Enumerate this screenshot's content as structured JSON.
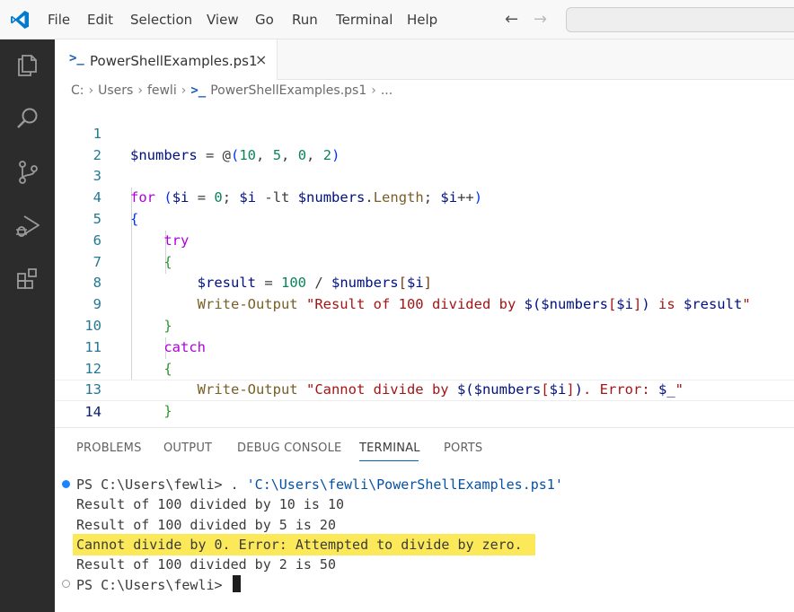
{
  "menu": [
    "File",
    "Edit",
    "Selection",
    "View",
    "Go",
    "Run",
    "Terminal",
    "Help"
  ],
  "nav": {
    "back": "←",
    "forward": "→"
  },
  "tab": {
    "label": "PowerShellExamples.ps1",
    "icon": ">_",
    "close": "×"
  },
  "breadcrumb": {
    "items": [
      "C:",
      "Users",
      "fewli"
    ],
    "file_icon": ">_",
    "file": "PowerShellExamples.ps1",
    "more": "...",
    "separator": "›"
  },
  "editor": {
    "line_numbers": [
      "1",
      "2",
      "3",
      "4",
      "5",
      "6",
      "7",
      "8",
      "9",
      "10",
      "11",
      "12",
      "13",
      "14"
    ],
    "lines": [
      "$numbers = @(10, 5, 0, 2)",
      "",
      "for ($i = 0; $i -lt $numbers.Length; $i++)",
      "{",
      "    try",
      "    {",
      "        $result = 100 / $numbers[$i]",
      "        Write-Output \"Result of 100 divided by $($numbers[$i]) is $result\"",
      "    }",
      "    catch",
      "    {",
      "        Write-Output \"Cannot divide by $($numbers[$i]). Error: $_\"",
      "    }",
      "}"
    ],
    "current_line": 14
  },
  "panel": {
    "tabs": [
      "PROBLEMS",
      "OUTPUT",
      "DEBUG CONSOLE",
      "TERMINAL",
      "PORTS"
    ],
    "active_tab": "TERMINAL"
  },
  "terminal": {
    "prompt_1": "PS C:\\Users\\fewli> ",
    "command_op": ". ",
    "command_path": "'C:\\Users\\fewli\\PowerShellExamples.ps1'",
    "output": [
      "Result of 100 divided by 10 is 10",
      "Result of 100 divided by 5 is 20",
      "Cannot divide by 0. Error: Attempted to divide by zero.",
      "Result of 100 divided by 2 is 50"
    ],
    "highlighted_line": "Cannot divide by 0. Error: Attempted to divide by zero.",
    "highlight_color": "#fce95a",
    "prompt_2": "PS C:\\Users\\fewli> "
  },
  "colors": {
    "activity_bar": "#2c2c2c",
    "accent": "#005fb8",
    "variable": "#001080",
    "keyword": "#af00db",
    "number": "#098658",
    "string": "#a31515",
    "function": "#795e26"
  },
  "icons": {
    "activity": [
      "explorer-icon",
      "search-icon",
      "source-control-icon",
      "run-debug-icon",
      "extensions-icon"
    ]
  }
}
